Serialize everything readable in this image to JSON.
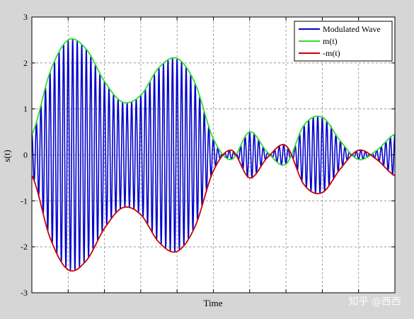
{
  "chart_data": {
    "type": "line",
    "title": "",
    "xlabel": "Time",
    "ylabel": "s(t)",
    "xlim": [
      0,
      10
    ],
    "ylim": [
      -3,
      3
    ],
    "xticks": [
      1,
      2,
      3,
      4,
      5,
      6,
      7,
      8,
      9
    ],
    "yticks": [
      -3,
      -2,
      -1,
      0,
      1,
      2,
      3
    ],
    "grid": true,
    "legend_position": "top-right",
    "carrier_cycles_per_unit": 8,
    "series": [
      {
        "name": "Modulated Wave",
        "color": "#0000cc",
        "role": "carrier modulated by m(t)",
        "x": [
          0,
          0.5,
          1,
          1.5,
          2,
          2.5,
          3,
          3.5,
          4,
          4.5,
          5,
          5.5,
          6,
          6.5,
          7,
          7.5,
          8,
          8.5,
          9,
          9.5,
          10
        ],
        "y": [
          0.45,
          1.8,
          2.5,
          2.3,
          1.6,
          1.15,
          1.3,
          1.9,
          2.1,
          1.55,
          0.35,
          -0.1,
          0.5,
          0.05,
          -0.2,
          0.65,
          0.82,
          0.3,
          -0.1,
          0.1,
          0.45
        ]
      },
      {
        "name": "m(t)",
        "color": "#33dd33",
        "x": [
          0,
          0.5,
          1,
          1.5,
          2,
          2.5,
          3,
          3.5,
          4,
          4.5,
          5,
          5.5,
          6,
          6.5,
          7,
          7.5,
          8,
          8.5,
          9,
          9.5,
          10
        ],
        "y": [
          0.45,
          1.8,
          2.5,
          2.3,
          1.6,
          1.15,
          1.3,
          1.9,
          2.1,
          1.55,
          0.35,
          -0.1,
          0.5,
          0.05,
          -0.2,
          0.65,
          0.82,
          0.3,
          -0.1,
          0.1,
          0.45
        ]
      },
      {
        "name": "-m(t)",
        "color": "#cc0000",
        "x": [
          0,
          0.5,
          1,
          1.5,
          2,
          2.5,
          3,
          3.5,
          4,
          4.5,
          5,
          5.5,
          6,
          6.5,
          7,
          7.5,
          8,
          8.5,
          9,
          9.5,
          10
        ],
        "y": [
          -0.45,
          -1.8,
          -2.5,
          -2.3,
          -1.6,
          -1.15,
          -1.3,
          -1.9,
          -2.1,
          -1.55,
          -0.35,
          0.1,
          -0.5,
          -0.05,
          0.2,
          -0.65,
          -0.82,
          -0.3,
          0.1,
          -0.1,
          -0.45
        ]
      }
    ]
  },
  "watermark": {
    "text": "知乎 @西西"
  }
}
